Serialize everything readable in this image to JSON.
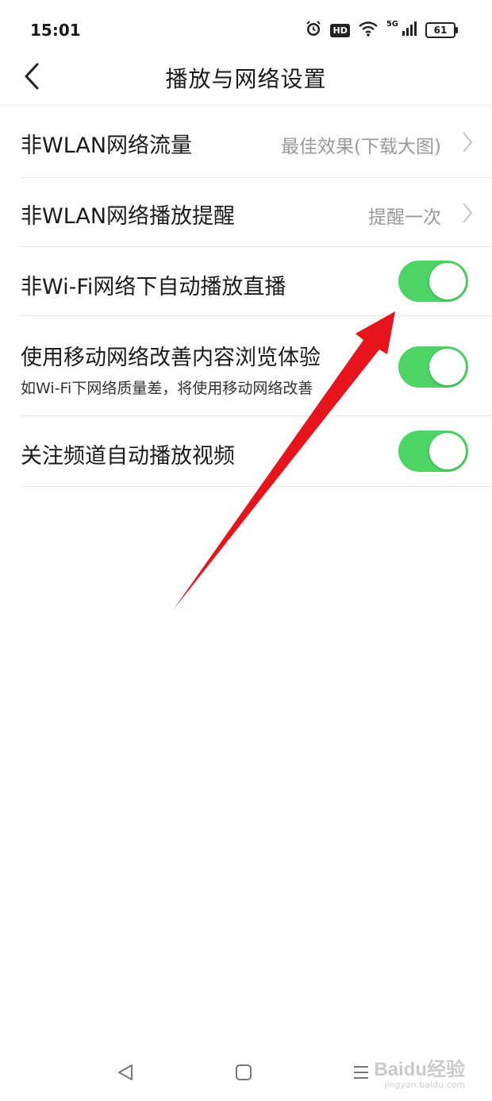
{
  "status_bar": {
    "time": "15:01",
    "network_label": "5G",
    "hd_label": "HD",
    "battery": "61"
  },
  "header": {
    "title": "播放与网络设置"
  },
  "settings": [
    {
      "label": "非WLAN网络流量",
      "value": "最佳效果(下载大图)"
    },
    {
      "label": "非WLAN网络播放提醒",
      "value": "提醒一次"
    },
    {
      "label": "非Wi-Fi网络下自动播放直播",
      "toggle_on": true
    },
    {
      "label": "使用移动网络改善内容浏览体验",
      "subtitle": "如Wi-Fi下网络质量差，将使用移动网络改善",
      "toggle_on": true
    },
    {
      "label": "关注频道自动播放视频",
      "toggle_on": true
    }
  ],
  "colors": {
    "toggle_on": "#4cd464",
    "annotation_arrow": "#e8141b"
  },
  "watermark": {
    "brand": "Baidu经验",
    "url": "jingyan.baidu.com"
  }
}
